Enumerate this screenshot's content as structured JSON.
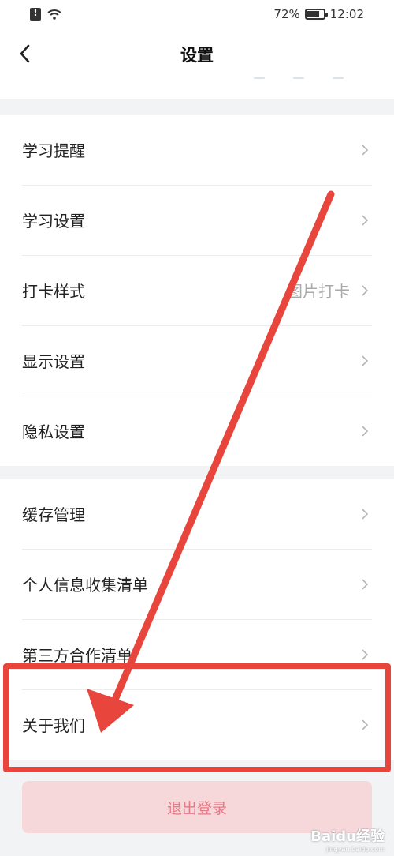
{
  "status_bar": {
    "battery_percent": "72%",
    "time": "12:02"
  },
  "nav": {
    "title": "设置"
  },
  "settings_group_1": [
    {
      "label": "学习提醒",
      "value": ""
    },
    {
      "label": "学习设置",
      "value": ""
    },
    {
      "label": "打卡样式",
      "value": "图片打卡"
    },
    {
      "label": "显示设置",
      "value": ""
    },
    {
      "label": "隐私设置",
      "value": ""
    }
  ],
  "settings_group_2": [
    {
      "label": "缓存管理",
      "value": ""
    },
    {
      "label": "个人信息收集清单",
      "value": ""
    },
    {
      "label": "第三方合作清单",
      "value": ""
    },
    {
      "label": "关于我们",
      "value": ""
    }
  ],
  "logout_label": "退出登录",
  "watermark": {
    "brand": "Baidu经验",
    "url": "jingyan.baidu.com"
  },
  "colors": {
    "annotation": "#e8453c",
    "logout_bg": "#f6d7da",
    "logout_text": "#e37a86"
  },
  "icons": {
    "back": "chevron-left-icon",
    "row_arrow": "chevron-right-icon"
  }
}
